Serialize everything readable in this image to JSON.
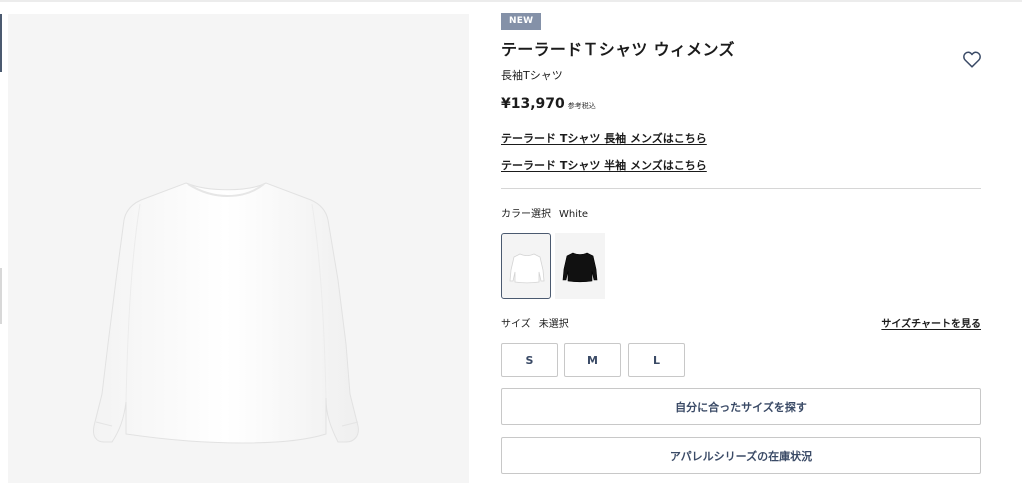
{
  "product": {
    "badge": "NEW",
    "title": "テーラードＴシャツ ウィメンズ",
    "subtitle": "長袖Tシャツ",
    "price": "¥13,970",
    "price_note": "参考税込",
    "image_color": "#ffffff"
  },
  "links": [
    "テーラード Tシャツ 長袖 メンズはこちら",
    "テーラード Tシャツ 半袖 メンズはこちら"
  ],
  "color_selector": {
    "label": "カラー選択",
    "selected_value": "White",
    "swatches": [
      {
        "name": "White",
        "color": "#ffffff",
        "selected": true
      },
      {
        "name": "Black",
        "color": "#111111",
        "selected": false
      }
    ]
  },
  "size_selector": {
    "label": "サイズ",
    "selected_value": "未選択",
    "chart_link": "サイズチャートを見る",
    "options": [
      "S",
      "M",
      "L"
    ]
  },
  "buttons": {
    "find_size": "自分に合ったサイズを探す",
    "stock_status": "アパレルシリーズの在庫状況"
  },
  "icons": {
    "favorite": "heart-outline-icon"
  },
  "colors": {
    "accent": "#4b5a70",
    "badge_bg": "#8491a8",
    "button_text": "#3a4a66",
    "border": "#c8c8c8"
  }
}
